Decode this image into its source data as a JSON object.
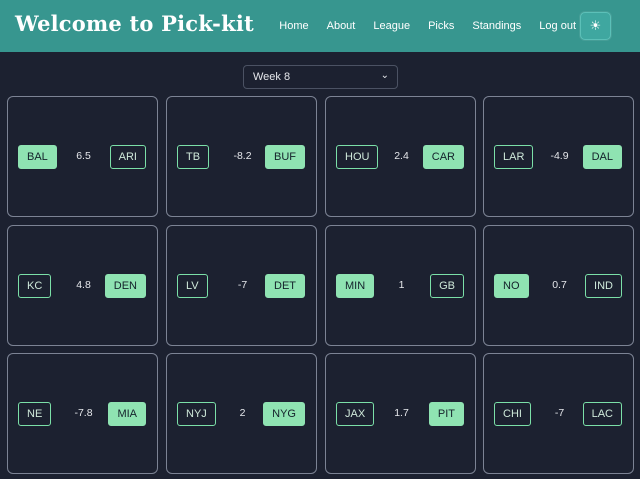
{
  "header": {
    "title": "Welcome to Pick-kit",
    "nav": [
      "Home",
      "About",
      "League",
      "Picks",
      "Standings",
      "Log out"
    ],
    "theme_icon": "sun-icon",
    "theme_glyph": "☀"
  },
  "week_select": {
    "value": "Week 8",
    "chevron": "⌄"
  },
  "colors": {
    "header_bg": "#37968f",
    "page_bg": "#1c2130",
    "selected_team_bg": "#8fe3b2",
    "card_border": "#7c8394"
  },
  "games": [
    {
      "away": "BAL",
      "spread": "6.5",
      "home": "ARI",
      "selected": "away"
    },
    {
      "away": "TB",
      "spread": "-8.2",
      "home": "BUF",
      "selected": "home"
    },
    {
      "away": "HOU",
      "spread": "2.4",
      "home": "CAR",
      "selected": "home"
    },
    {
      "away": "LAR",
      "spread": "-4.9",
      "home": "DAL",
      "selected": "home"
    },
    {
      "away": "KC",
      "spread": "4.8",
      "home": "DEN",
      "selected": "home"
    },
    {
      "away": "LV",
      "spread": "-7",
      "home": "DET",
      "selected": "home"
    },
    {
      "away": "MIN",
      "spread": "1",
      "home": "GB",
      "selected": "away"
    },
    {
      "away": "NO",
      "spread": "0.7",
      "home": "IND",
      "selected": "away"
    },
    {
      "away": "NE",
      "spread": "-7.8",
      "home": "MIA",
      "selected": "home"
    },
    {
      "away": "NYJ",
      "spread": "2",
      "home": "NYG",
      "selected": "home"
    },
    {
      "away": "JAX",
      "spread": "1.7",
      "home": "PIT",
      "selected": "home"
    },
    {
      "away": "CHI",
      "spread": "-7",
      "home": "LAC",
      "selected": "none"
    }
  ]
}
